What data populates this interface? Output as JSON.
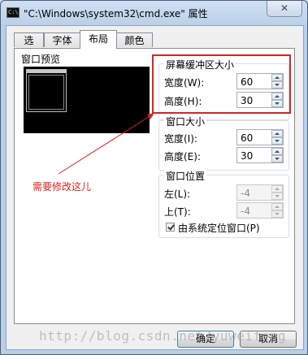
{
  "window": {
    "title": "\"C:\\Windows\\system32\\cmd.exe\" 属性",
    "close_glyph": "✕",
    "icon": "console-window-icon",
    "icon_text": "C:\\"
  },
  "tabs": [
    {
      "label": "选项"
    },
    {
      "label": "字体"
    },
    {
      "label": "布局",
      "active": true
    },
    {
      "label": "颜色"
    }
  ],
  "preview": {
    "label": "窗口预览"
  },
  "buffer_size": {
    "title": "屏幕缓冲区大小",
    "width_label": "宽度(W):",
    "width_value": "60",
    "height_label": "高度(H):",
    "height_value": "30"
  },
  "window_size": {
    "title": "窗口大小",
    "width_label": "宽度(I):",
    "width_value": "60",
    "height_label": "高度(E):",
    "height_value": "30"
  },
  "window_position": {
    "title": "窗口位置",
    "left_label": "左(L):",
    "left_value": "-4",
    "top_label": "上(T):",
    "top_value": "-4",
    "system_position_label": "由系统定位窗口(P)",
    "system_position_checked": true
  },
  "buttons": {
    "ok": "确定",
    "cancel": "取消"
  },
  "annotation": {
    "text": "需要修改这儿",
    "color": "#e02020"
  },
  "watermark": "http://blog.csdn.net/yuweifeng"
}
